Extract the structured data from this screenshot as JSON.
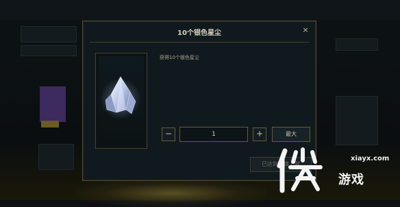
{
  "dialog": {
    "title": "10个银色星尘",
    "close_icon": "×",
    "description": "获得10个银色星尘",
    "quantity": "1",
    "decrement_label": "−",
    "increment_label": "+",
    "max_label": "最大",
    "redeem_label": "已达到兑换上限"
  },
  "watermark": {
    "domain": "xiayx.com",
    "brand": "游戏"
  },
  "icons": [
    "close-icon",
    "crystal-icon",
    "minus-icon",
    "plus-icon",
    "logo-mark"
  ],
  "colors": {
    "accent_gold": "#6a5a36",
    "panel_bg": "#101a1e",
    "text_primary": "#d8d1bd"
  }
}
